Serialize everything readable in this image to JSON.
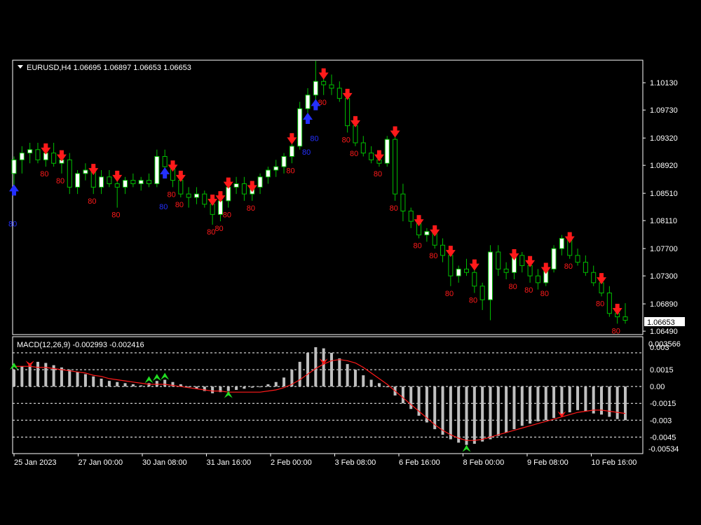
{
  "colors": {
    "background": "#000000",
    "frame": "#ffffff",
    "bull_candle": "#ffffff",
    "bear_candle": "#000000",
    "wick": "#00c000",
    "sell_arrow": "#ff1a1a",
    "buy_arrow": "#2430ff",
    "macd_hist": "#c0c0c0",
    "macd_signal": "#ff1a1a",
    "macd_buy_arrow": "#22dd22",
    "text": "#ffffff",
    "label_red": "#ff1a1a",
    "label_blue": "#2430ff"
  },
  "header": {
    "symbol_line": "EURUSD,H4  1.06695 1.06897 1.06653 1.06653",
    "dropdown_icon": "triangle-down-icon"
  },
  "price_axis": {
    "ticks": [
      "1.10130",
      "1.09730",
      "1.09320",
      "1.08920",
      "1.08510",
      "1.08110",
      "1.07700",
      "1.07300",
      "1.06890",
      "1.06490"
    ],
    "current_price": "1.06653"
  },
  "macd": {
    "title": "MACD(12,26,9) -0.002993 -0.002416",
    "ticks": [
      "0.0015",
      "0.00",
      "-0.0015",
      "-0.003",
      "-0.0045"
    ],
    "top_label": "0.003566",
    "top_label_overlap": "0.003",
    "bottom_label": "-0.00534"
  },
  "time_axis": {
    "labels": [
      "25 Jan 2023",
      "27 Jan 00:00",
      "30 Jan 08:00",
      "31 Jan 16:00",
      "2 Feb 00:00",
      "3 Feb 08:00",
      "6 Feb 16:00",
      "8 Feb 00:00",
      "9 Feb 08:00",
      "10 Feb 16:00"
    ]
  },
  "arrow_label": "80",
  "chart_data": {
    "type": "candlestick",
    "symbol": "EURUSD",
    "timeframe": "H4",
    "ylim": [
      1.0645,
      1.1045
    ],
    "x_count": 78,
    "candles": [
      [
        1.088,
        1.0905,
        1.086,
        1.09
      ],
      [
        1.09,
        1.092,
        1.088,
        1.091
      ],
      [
        1.091,
        1.0925,
        1.0895,
        1.0915
      ],
      [
        1.0915,
        1.0925,
        1.0895,
        1.09
      ],
      [
        1.09,
        1.092,
        1.089,
        1.091
      ],
      [
        1.091,
        1.0925,
        1.089,
        1.0895
      ],
      [
        1.0895,
        1.091,
        1.088,
        1.09
      ],
      [
        1.09,
        1.091,
        1.085,
        1.086
      ],
      [
        1.086,
        1.0885,
        1.085,
        1.088
      ],
      [
        1.088,
        1.0895,
        1.087,
        1.0885
      ],
      [
        1.0885,
        1.089,
        1.085,
        1.086
      ],
      [
        1.086,
        1.0885,
        1.085,
        1.0875
      ],
      [
        1.0875,
        1.0885,
        1.086,
        1.0865
      ],
      [
        1.0865,
        1.088,
        1.083,
        1.086
      ],
      [
        1.086,
        1.0875,
        1.085,
        1.087
      ],
      [
        1.087,
        1.088,
        1.086,
        1.0865
      ],
      [
        1.0865,
        1.0875,
        1.0855,
        1.087
      ],
      [
        1.087,
        1.088,
        1.086,
        1.0865
      ],
      [
        1.0865,
        1.0915,
        1.086,
        1.0905
      ],
      [
        1.0905,
        1.0915,
        1.0885,
        1.089
      ],
      [
        1.089,
        1.0895,
        1.086,
        1.087
      ],
      [
        1.087,
        1.088,
        1.0845,
        1.085
      ],
      [
        1.085,
        1.086,
        1.083,
        1.0845
      ],
      [
        1.0845,
        1.086,
        1.0835,
        1.085
      ],
      [
        1.085,
        1.0855,
        1.083,
        1.0835
      ],
      [
        1.0835,
        1.0845,
        1.0805,
        1.082
      ],
      [
        1.082,
        1.085,
        1.081,
        1.084
      ],
      [
        1.084,
        1.087,
        1.083,
        1.086
      ],
      [
        1.086,
        1.0875,
        1.085,
        1.0865
      ],
      [
        1.0865,
        1.0875,
        1.084,
        1.085
      ],
      [
        1.085,
        1.0865,
        1.084,
        1.086
      ],
      [
        1.086,
        1.088,
        1.085,
        1.0875
      ],
      [
        1.0875,
        1.089,
        1.0865,
        1.0885
      ],
      [
        1.0885,
        1.09,
        1.0875,
        1.089
      ],
      [
        1.089,
        1.091,
        1.088,
        1.0905
      ],
      [
        1.0905,
        1.0935,
        1.0895,
        1.092
      ],
      [
        1.092,
        1.0985,
        1.0915,
        1.0975
      ],
      [
        1.0975,
        1.1005,
        1.0965,
        1.0995
      ],
      [
        1.0995,
        1.1045,
        1.0985,
        1.1015
      ],
      [
        1.1015,
        1.103,
        1.0995,
        1.101
      ],
      [
        1.101,
        1.1025,
        1.0995,
        1.1005
      ],
      [
        1.1005,
        1.1015,
        1.0985,
        1.099
      ],
      [
        1.099,
        1.1,
        1.094,
        1.095
      ],
      [
        1.095,
        1.096,
        1.092,
        1.0925
      ],
      [
        1.0925,
        1.0935,
        1.0905,
        1.091
      ],
      [
        1.091,
        1.092,
        1.0895,
        1.09
      ],
      [
        1.09,
        1.091,
        1.089,
        1.0895
      ],
      [
        1.0895,
        1.0935,
        1.089,
        1.093
      ],
      [
        1.093,
        1.0945,
        1.084,
        1.085
      ],
      [
        1.085,
        1.0865,
        1.081,
        1.0825
      ],
      [
        1.0825,
        1.083,
        1.08,
        1.081
      ],
      [
        1.081,
        1.0815,
        1.0785,
        1.079
      ],
      [
        1.079,
        1.08,
        1.078,
        1.0795
      ],
      [
        1.0795,
        1.08,
        1.077,
        1.0775
      ],
      [
        1.0775,
        1.0785,
        1.075,
        1.076
      ],
      [
        1.076,
        1.077,
        1.0715,
        1.073
      ],
      [
        1.073,
        1.0745,
        1.072,
        1.074
      ],
      [
        1.074,
        1.0755,
        1.073,
        1.0735
      ],
      [
        1.0735,
        1.075,
        1.0705,
        1.0715
      ],
      [
        1.0715,
        1.072,
        1.068,
        1.0695
      ],
      [
        1.0695,
        1.0775,
        1.0665,
        1.0765
      ],
      [
        1.0765,
        1.0775,
        1.073,
        1.074
      ],
      [
        1.074,
        1.075,
        1.0725,
        1.0735
      ],
      [
        1.0735,
        1.0765,
        1.0725,
        1.076
      ],
      [
        1.076,
        1.0765,
        1.0735,
        1.0745
      ],
      [
        1.0745,
        1.0755,
        1.072,
        1.073
      ],
      [
        1.073,
        1.074,
        1.071,
        1.072
      ],
      [
        1.072,
        1.0745,
        1.0715,
        1.074
      ],
      [
        1.074,
        1.0775,
        1.0735,
        1.077
      ],
      [
        1.077,
        1.079,
        1.076,
        1.0785
      ],
      [
        1.0785,
        1.079,
        1.0755,
        1.076
      ],
      [
        1.076,
        1.077,
        1.0745,
        1.075
      ],
      [
        1.075,
        1.076,
        1.073,
        1.0735
      ],
      [
        1.0735,
        1.0745,
        1.0715,
        1.072
      ],
      [
        1.072,
        1.073,
        1.07,
        1.0705
      ],
      [
        1.0705,
        1.0715,
        1.067,
        1.0675
      ],
      [
        1.0675,
        1.0685,
        1.066,
        1.067
      ],
      [
        1.067,
        1.069,
        1.066,
        1.0665
      ]
    ],
    "sell_signals": [
      4,
      6,
      10,
      13,
      20,
      21,
      25,
      26,
      27,
      30,
      35,
      39,
      42,
      43,
      46,
      48,
      51,
      53,
      55,
      58,
      63,
      65,
      67,
      70,
      74,
      76
    ],
    "buy_signals": [
      0,
      19,
      37,
      38
    ],
    "macd_histogram": [
      0.0015,
      0.0018,
      0.002,
      0.0022,
      0.0021,
      0.0019,
      0.0017,
      0.0015,
      0.0013,
      0.0011,
      0.0009,
      0.0007,
      0.0005,
      0.0004,
      0.0003,
      0.0002,
      0.0001,
      0.0003,
      0.0005,
      0.0006,
      0.0004,
      0.0002,
      0.0,
      -0.0002,
      -0.0004,
      -0.0006,
      -0.0005,
      -0.0004,
      -0.0003,
      -0.0002,
      -0.0001,
      0.0,
      0.0002,
      0.0004,
      0.0008,
      0.0015,
      0.0022,
      0.003,
      0.0035,
      0.0034,
      0.003,
      0.0025,
      0.002,
      0.0015,
      0.001,
      0.0006,
      0.0003,
      0.0,
      -0.0008,
      -0.0015,
      -0.002,
      -0.0026,
      -0.0032,
      -0.0038,
      -0.0043,
      -0.0047,
      -0.005,
      -0.0052,
      -0.0051,
      -0.0049,
      -0.0047,
      -0.0044,
      -0.0041,
      -0.0038,
      -0.0035,
      -0.0033,
      -0.0031,
      -0.003,
      -0.0028,
      -0.0026,
      -0.0023,
      -0.0021,
      -0.0022,
      -0.0024,
      -0.0025,
      -0.0027,
      -0.0029,
      -0.003
    ],
    "macd_signal": [
      0.0018,
      0.0018,
      0.0018,
      0.0017,
      0.0017,
      0.0016,
      0.0015,
      0.0014,
      0.0013,
      0.0012,
      0.001,
      0.0009,
      0.0007,
      0.0006,
      0.0005,
      0.0004,
      0.0003,
      0.0002,
      0.0002,
      0.0002,
      0.0001,
      0.0,
      -0.0001,
      -0.0002,
      -0.0003,
      -0.0004,
      -0.0004,
      -0.0005,
      -0.0005,
      -0.0005,
      -0.0005,
      -0.0005,
      -0.0004,
      -0.0003,
      -0.0001,
      0.0002,
      0.0006,
      0.0011,
      0.0016,
      0.002,
      0.0023,
      0.0024,
      0.0023,
      0.0021,
      0.0017,
      0.0012,
      0.0007,
      0.0002,
      -0.0004,
      -0.001,
      -0.0016,
      -0.0022,
      -0.0028,
      -0.0034,
      -0.0039,
      -0.0043,
      -0.0046,
      -0.0048,
      -0.0048,
      -0.0047,
      -0.0045,
      -0.0043,
      -0.0041,
      -0.0039,
      -0.0037,
      -0.0035,
      -0.0033,
      -0.0031,
      -0.0029,
      -0.0027,
      -0.0025,
      -0.0023,
      -0.0022,
      -0.0021,
      -0.0021,
      -0.0022,
      -0.0023,
      -0.0024
    ],
    "macd_sell_arrows": [
      2,
      39,
      69
    ],
    "macd_buy_arrows": [
      0,
      17,
      18,
      19,
      27,
      57
    ]
  }
}
